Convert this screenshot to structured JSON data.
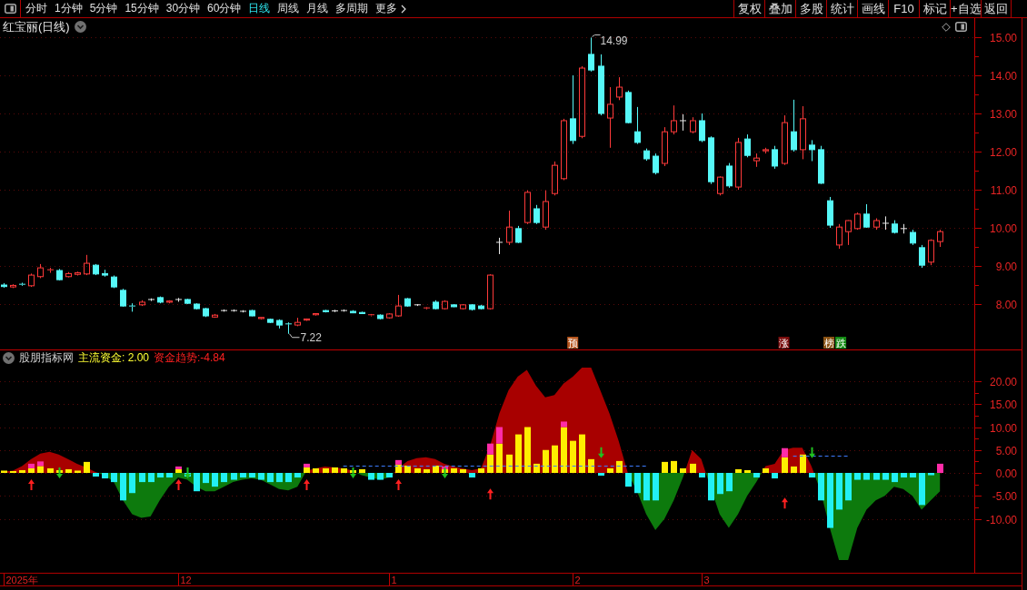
{
  "toolbar": {
    "tabs": [
      {
        "label": "分时",
        "selected": false,
        "kind": "period"
      },
      {
        "label": "1分钟",
        "selected": false,
        "kind": "period"
      },
      {
        "label": "5分钟",
        "selected": false,
        "kind": "period"
      },
      {
        "label": "15分钟",
        "selected": false,
        "kind": "period"
      },
      {
        "label": "30分钟",
        "selected": false,
        "kind": "period"
      },
      {
        "label": "60分钟",
        "selected": false,
        "kind": "period"
      },
      {
        "label": "日线",
        "selected": true,
        "kind": "period"
      },
      {
        "label": "周线",
        "selected": false,
        "kind": "period"
      },
      {
        "label": "月线",
        "selected": false,
        "kind": "period"
      },
      {
        "label": "多周期",
        "selected": false,
        "kind": "period"
      },
      {
        "label": "更多",
        "selected": false,
        "kind": "menu"
      }
    ],
    "buttons": [
      "复权",
      "叠加",
      "多股",
      "统计",
      "画线",
      "F10",
      "标记",
      "+自选",
      "返回"
    ]
  },
  "price_panel": {
    "title": "红宝丽(日线)",
    "axis_labels": [
      "15.00",
      "14.00",
      "13.00",
      "12.00",
      "11.00",
      "10.00",
      "9.00",
      "8.00"
    ],
    "high_label": "14.99",
    "low_label": "7.22",
    "tags": [
      {
        "text": "预",
        "color": "#b5541c"
      },
      {
        "text": "涨",
        "color": "#7a0c0c"
      },
      {
        "text": "榜",
        "color": "#8a5214"
      },
      {
        "text": "跌",
        "color": "#138a13"
      }
    ]
  },
  "indicator_panel": {
    "title": "股朋指标网",
    "readings": [
      {
        "text": "主流资金: 2.00",
        "color": "#ffff33"
      },
      {
        "text": "资金趋势:-4.84",
        "color": "#ff2020"
      }
    ],
    "axis_labels": [
      "20.00",
      "15.00",
      "10.00",
      "5.00",
      "0.00",
      "-5.00",
      "-10.00"
    ]
  },
  "time_axis": {
    "labels": [
      "2025年",
      "12",
      "1",
      "2",
      "3"
    ]
  }
}
